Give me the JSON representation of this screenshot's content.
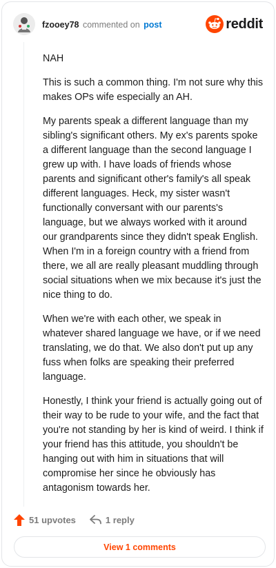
{
  "header": {
    "username": "fzooey78",
    "action_text": "commented on",
    "post_link": "post",
    "brand": "reddit",
    "brand_color": "#ff4500",
    "avatar_icon": "avatar-icon"
  },
  "comment": {
    "paragraphs": [
      "NAH",
      "This is such a common thing. I'm not sure why this makes OPs wife especially an AH.",
      "My parents speak a different language than my sibling's significant others. My ex's parents spoke a different language than the second language I grew up with. I have loads of friends whose parents and significant other's family's all speak different languages. Heck, my sister wasn't functionally conversant with our parents's language, but we always worked with it around our grandparents since they didn't speak English. When I'm in a foreign country with a friend from there, we all are really pleasant muddling through social situations when we mix because it's just the nice thing to do.",
      "When we're with each other, we speak in whatever shared language we have, or if we need translating, we do that. We also don't put up any fuss when folks are speaking their preferred language.",
      "Honestly, I think your friend is actually going out of their way to be rude to your wife, and the fact that you're not standing by her is kind of weird. I think if your friend has this attitude, you shouldn't be hanging out with him in situations that will compromise her since he obviously has antagonism towards her."
    ]
  },
  "actions": {
    "upvotes": "51 upvotes",
    "replies": "1 reply",
    "upvote_icon": "upvote-arrow-icon",
    "reply_icon": "reply-arrow-icon",
    "upvote_color": "#ff4500"
  },
  "footer": {
    "view_comments": "View 1 comments"
  }
}
